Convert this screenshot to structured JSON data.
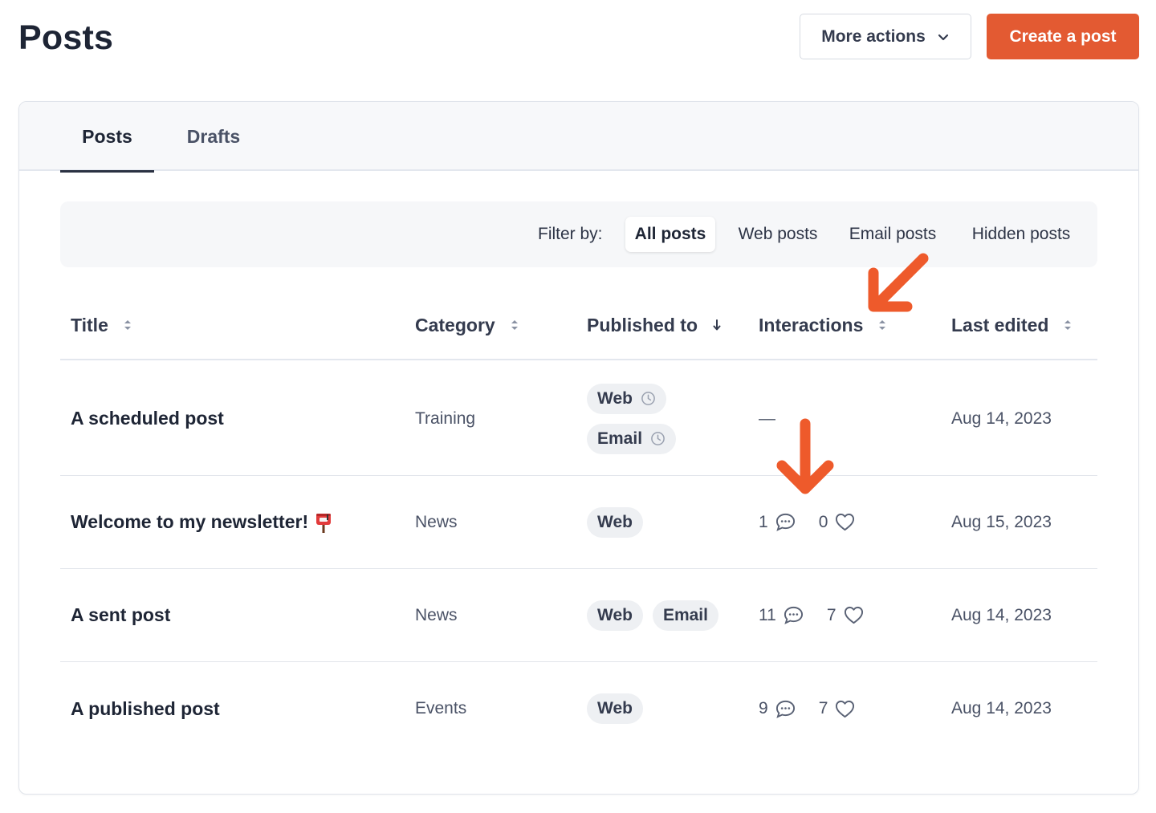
{
  "header": {
    "title": "Posts",
    "more_actions_label": "More actions",
    "create_label": "Create a post"
  },
  "tabs": [
    {
      "label": "Posts",
      "active": true
    },
    {
      "label": "Drafts",
      "active": false
    }
  ],
  "filter": {
    "label": "Filter by:",
    "options": [
      "All posts",
      "Web posts",
      "Email posts",
      "Hidden posts"
    ],
    "selected": "All posts"
  },
  "table": {
    "columns": [
      "Title",
      "Category",
      "Published to",
      "Interactions",
      "Last edited"
    ],
    "sorted_column": "Published to",
    "rows": [
      {
        "title": "A scheduled post",
        "category": "Training",
        "published_to": [
          "Web",
          "Email"
        ],
        "scheduled": true,
        "interactions": "—",
        "comments": "",
        "likes": "",
        "last_edited": "Aug 14, 2023"
      },
      {
        "title": "Welcome to my newsletter!",
        "title_icon": "mailbox-icon",
        "category": "News",
        "published_to": [
          "Web"
        ],
        "comments": "1",
        "likes": "0",
        "last_edited": "Aug 15, 2023"
      },
      {
        "title": "A sent post",
        "category": "News",
        "published_to": [
          "Web",
          "Email"
        ],
        "comments": "11",
        "likes": "7",
        "last_edited": "Aug 14, 2023"
      },
      {
        "title": "A published post",
        "category": "Events",
        "published_to": [
          "Web"
        ],
        "comments": "9",
        "likes": "7",
        "last_edited": "Aug 14, 2023"
      }
    ]
  },
  "colors": {
    "accent": "#e35a32",
    "annotation_arrow": "#ee5a2b",
    "text_primary": "#1e2535",
    "tag_bg": "#eef0f3"
  }
}
